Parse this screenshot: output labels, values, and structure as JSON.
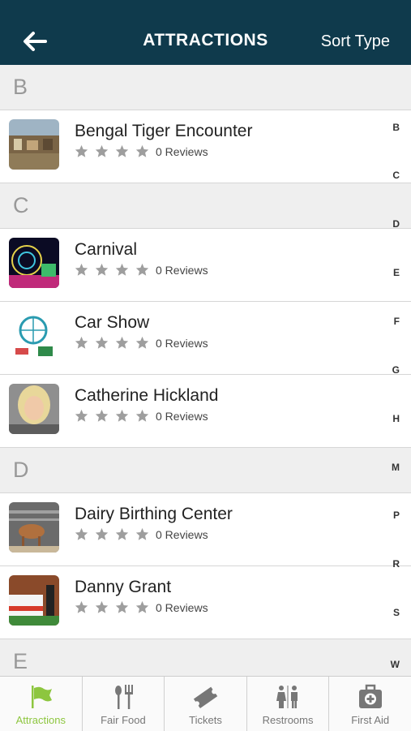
{
  "header": {
    "title": "ATTRACTIONS",
    "sort_label": "Sort Type"
  },
  "sections": [
    {
      "letter": "B",
      "items": [
        {
          "name": "Bengal Tiger Encounter",
          "reviews": "0 Reviews"
        }
      ]
    },
    {
      "letter": "C",
      "items": [
        {
          "name": "Carnival",
          "reviews": "0 Reviews"
        },
        {
          "name": "Car Show",
          "reviews": "0 Reviews"
        },
        {
          "name": "Catherine Hickland",
          "reviews": "0 Reviews"
        }
      ]
    },
    {
      "letter": "D",
      "items": [
        {
          "name": "Dairy Birthing Center",
          "reviews": "0 Reviews"
        },
        {
          "name": "Danny Grant",
          "reviews": "0 Reviews"
        }
      ]
    },
    {
      "letter": "E",
      "items": []
    }
  ],
  "index_letters": [
    "B",
    "C",
    "D",
    "E",
    "F",
    "G",
    "H",
    "M",
    "P",
    "R",
    "S",
    "W"
  ],
  "tabs": [
    {
      "label": "Attractions",
      "icon": "flag-icon"
    },
    {
      "label": "Fair Food",
      "icon": "fork-spoon-icon"
    },
    {
      "label": "Tickets",
      "icon": "ticket-icon"
    },
    {
      "label": "Restrooms",
      "icon": "restroom-icon"
    },
    {
      "label": "First Aid",
      "icon": "first-aid-icon"
    }
  ],
  "colors": {
    "header": "#0f3a4c",
    "accent": "#8dc63f"
  }
}
